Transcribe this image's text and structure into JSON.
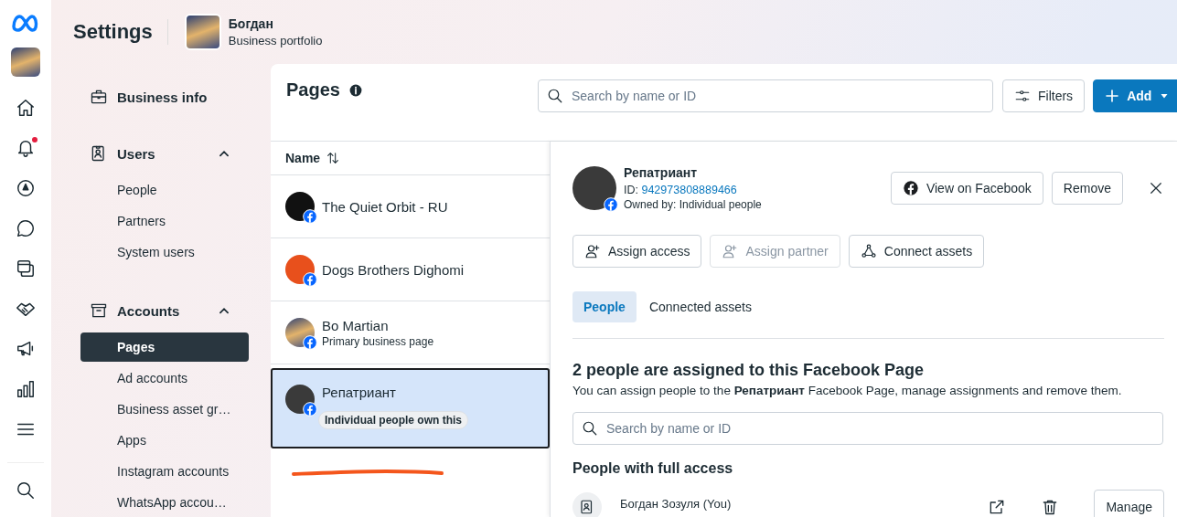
{
  "header": {
    "title": "Settings",
    "portfolio_name": "Богдан",
    "portfolio_subtitle": "Business portfolio"
  },
  "nav": [
    {
      "kind": "link",
      "label": "Business info"
    },
    {
      "kind": "section",
      "label": "Users",
      "expanded": true,
      "items": [
        {
          "label": "People",
          "selected": false
        },
        {
          "label": "Partners",
          "selected": false
        },
        {
          "label": "System users",
          "selected": false
        }
      ]
    },
    {
      "kind": "section",
      "label": "Accounts",
      "expanded": true,
      "items": [
        {
          "label": "Pages",
          "selected": true
        },
        {
          "label": "Ad accounts",
          "selected": false
        },
        {
          "label": "Business asset gr…",
          "selected": false
        },
        {
          "label": "Apps",
          "selected": false
        },
        {
          "label": "Instagram accounts",
          "selected": false
        },
        {
          "label": "WhatsApp accou…",
          "selected": false
        }
      ]
    }
  ],
  "pages": {
    "title": "Pages",
    "search": {
      "placeholder": "Search by name or ID"
    },
    "filters_button": "Filters",
    "add_button": "Add",
    "column": "Name",
    "rows": [
      {
        "name": "The Quiet Orbit - RU",
        "selected": false
      },
      {
        "name": "Dogs Brothers Dighomi",
        "selected": false
      },
      {
        "name": "Bo Martian",
        "subtitle": "Primary business page",
        "selected": false
      },
      {
        "name": "Репатриант",
        "badge": "Individual people own this",
        "selected": true
      }
    ]
  },
  "detail": {
    "name": "Репатриант",
    "id_label": "ID:",
    "id": "942973808889466",
    "owner": "Owned by: Individual people",
    "view_button": "View on Facebook",
    "remove_button": "Remove",
    "actions": [
      {
        "label": "Assign access",
        "disabled": false
      },
      {
        "label": "Assign partner",
        "disabled": true
      },
      {
        "label": "Connect assets",
        "disabled": false
      }
    ],
    "tabs": [
      {
        "label": "People",
        "selected": true
      },
      {
        "label": "Connected assets",
        "selected": false
      }
    ],
    "heading": "2 people are assigned to this Facebook Page",
    "description": "You can assign people to the **Репатриант** Facebook Page, manage assignments and remove them.",
    "search": {
      "placeholder": "Search by name or ID"
    },
    "section_title": "People with full access",
    "people": [
      {
        "name": "Богдан Зозуля (You)",
        "button": "Manage"
      }
    ]
  }
}
